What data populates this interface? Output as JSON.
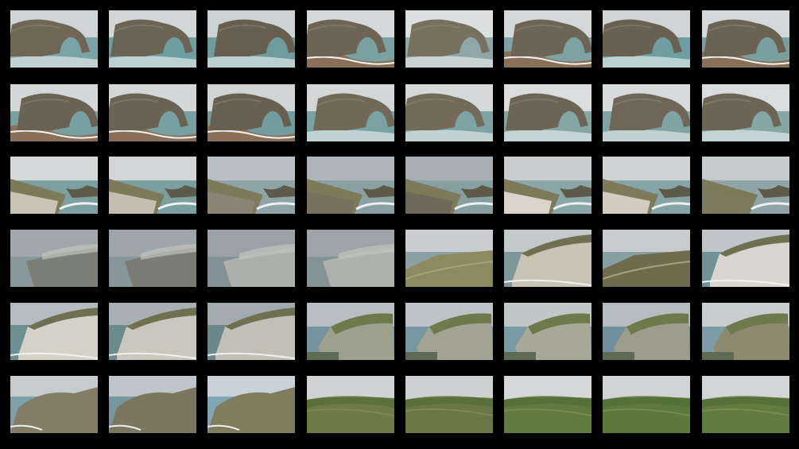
{
  "contact_sheet": {
    "rows": 6,
    "cols": 8,
    "background": "#000000",
    "thumbnails": [
      {
        "subject": "arch-rock-closeup",
        "sky": "#cfd4d6",
        "sea": "#7aa3a6",
        "rock": "#6f6656"
      },
      {
        "subject": "arch-rock-closeup",
        "sky": "#d2d6d7",
        "sea": "#6f9ea0",
        "rock": "#6b6354"
      },
      {
        "subject": "arch-rock-wave",
        "sky": "#cdd2d4",
        "sea": "#6e9c9d",
        "rock": "#675e50"
      },
      {
        "subject": "arch-rock-beach",
        "sky": "#d6d9da",
        "sea": "#7aa1a2",
        "rock": "#6d6455"
      },
      {
        "subject": "arch-rock-front",
        "sky": "#dde0e1",
        "sea": "#8fa7a8",
        "rock": "#76705f"
      },
      {
        "subject": "arch-rock-beach",
        "sky": "#d4d8d9",
        "sea": "#7fa2a4",
        "rock": "#6c6556"
      },
      {
        "subject": "arch-rock-wave",
        "sky": "#d0d4d5",
        "sea": "#6f9ea0",
        "rock": "#686051"
      },
      {
        "subject": "arch-rock-beach",
        "sky": "#d4d8d9",
        "sea": "#78a0a1",
        "rock": "#6a6253"
      },
      {
        "subject": "arch-rock-cove",
        "sky": "#d3d7d8",
        "sea": "#76a0a1",
        "rock": "#6a6252"
      },
      {
        "subject": "arch-rock-cove",
        "sky": "#d3d7d8",
        "sea": "#76a0a1",
        "rock": "#6a6252"
      },
      {
        "subject": "arch-rock-cove",
        "sky": "#d0d4d5",
        "sea": "#729c9d",
        "rock": "#685f50"
      },
      {
        "subject": "arch-rock-closeup",
        "sky": "#d2d6d7",
        "sea": "#7aa2a3",
        "rock": "#716858"
      },
      {
        "subject": "arch-rock-closeup",
        "sky": "#d6d9da",
        "sea": "#7da3a4",
        "rock": "#736a5a"
      },
      {
        "subject": "arch-rock-distant",
        "sky": "#dadddd",
        "sea": "#86a6a6",
        "rock": "#6c6455"
      },
      {
        "subject": "arch-rock-distant",
        "sky": "#d8dbdc",
        "sea": "#80a3a4",
        "rock": "#6f6657"
      },
      {
        "subject": "arch-rock-distant",
        "sky": "#dadddd",
        "sea": "#86a6a6",
        "rock": "#6c6455"
      },
      {
        "subject": "chalk-cliff-green",
        "sky": "#d6d9da",
        "sea": "#7d9fa1",
        "rock": "#c9c3b6"
      },
      {
        "subject": "chalk-cliff-green",
        "sky": "#d2d6d7",
        "sea": "#7b9ea0",
        "rock": "#c4beb1"
      },
      {
        "subject": "misty-headland",
        "sky": "#b9c0c3",
        "sea": "#8ea4a7",
        "rock": "#8a8474"
      },
      {
        "subject": "misty-headland",
        "sky": "#aeb6b9",
        "sea": "#8aa0a3",
        "rock": "#77705f"
      },
      {
        "subject": "misty-headland",
        "sky": "#a7afb2",
        "sea": "#889fa2",
        "rock": "#6f6859"
      },
      {
        "subject": "chalk-cliff-top",
        "sky": "#c9cdcf",
        "sea": "#8aa6a8",
        "rock": "#d8d4c9"
      },
      {
        "subject": "chalk-cliff-top",
        "sky": "#cfd3d4",
        "sea": "#86a3a5",
        "rock": "#d2cdc1"
      },
      {
        "subject": "coast-path",
        "sky": "#c5cacc",
        "sea": "#8fa4a6",
        "rock": "#7d7a5f"
      },
      {
        "subject": "misty-cliffs",
        "sky": "#a4abae",
        "sea": "#7c9294",
        "rock": "#6b6a5a"
      },
      {
        "subject": "misty-cliffs",
        "sky": "#a0a8ab",
        "sea": "#7a9193",
        "rock": "#6a6959"
      },
      {
        "subject": "misty-white-cliff",
        "sky": "#9aa2a5",
        "sea": "#76898b",
        "rock": "#b7b6ad"
      },
      {
        "subject": "misty-white-cliff",
        "sky": "#9ea6a9",
        "sea": "#788c8e",
        "rock": "#b9b8ae"
      },
      {
        "subject": "grass-path",
        "sky": "#c9cdcf",
        "sea": "#8ba0a2",
        "rock": "#8d8a62"
      },
      {
        "subject": "white-cliff-side",
        "sky": "#c4c9cb",
        "sea": "#7e9799",
        "rock": "#c9c3b4"
      },
      {
        "subject": "coast-view",
        "sky": "#c7cbcd",
        "sea": "#86a0a2",
        "rock": "#6f6b4f"
      },
      {
        "subject": "white-cliff-side",
        "sky": "#bfc5c8",
        "sea": "#6f9294",
        "rock": "#d8d6ce"
      },
      {
        "subject": "white-cliff-big",
        "sky": "#b5bcbf",
        "sea": "#6c8f92",
        "rock": "#d3d1c8"
      },
      {
        "subject": "white-cliff-side",
        "sky": "#a9b0b3",
        "sea": "#6b8a8c",
        "rock": "#c9c7be"
      },
      {
        "subject": "white-cliff-side",
        "sky": "#a2aaad",
        "sea": "#6a8789",
        "rock": "#c2c0b6"
      },
      {
        "subject": "mossy-rock",
        "sky": "#b8bec1",
        "sea": "#7594a0",
        "rock": "#9ea08e"
      },
      {
        "subject": "mossy-rock",
        "sky": "#bcc2c5",
        "sea": "#7798a2",
        "rock": "#a2a392"
      },
      {
        "subject": "mossy-rock",
        "sky": "#c1c6c8",
        "sea": "#7b9ba4",
        "rock": "#a7a896"
      },
      {
        "subject": "mossy-rock",
        "sky": "#b5bcc0",
        "sea": "#6f909c",
        "rock": "#9c9d8b"
      },
      {
        "subject": "mossy-rock",
        "sky": "#c8cdcf",
        "sea": "#7b9da8",
        "rock": "#8e8a6f"
      },
      {
        "subject": "rocky-shore",
        "sky": "#c6ccce",
        "sea": "#7fa0a8",
        "rock": "#837d66"
      },
      {
        "subject": "rocky-shore",
        "sky": "#bfc6c9",
        "sea": "#7697a0",
        "rock": "#7b765f"
      },
      {
        "subject": "headland-blue",
        "sky": "#c9d2d8",
        "sea": "#7fa6b5",
        "rock": "#7f7d5e"
      },
      {
        "subject": "green-hill",
        "sky": "#cfd3d4",
        "sea": "#9db0b2",
        "rock": "#6f7a47"
      },
      {
        "subject": "green-hill",
        "sky": "#cdd1d2",
        "sea": "#9aaeb0",
        "rock": "#6b7845"
      },
      {
        "subject": "green-valley",
        "sky": "#d4d8d8",
        "sea": "#a3b2b3",
        "rock": "#617a3d"
      },
      {
        "subject": "green-valley",
        "sky": "#d0d4d4",
        "sea": "#a0afb0",
        "rock": "#5e7a3b"
      },
      {
        "subject": "green-valley",
        "sky": "#d2d6d6",
        "sea": "#a2b1b2",
        "rock": "#627c3e"
      }
    ]
  }
}
